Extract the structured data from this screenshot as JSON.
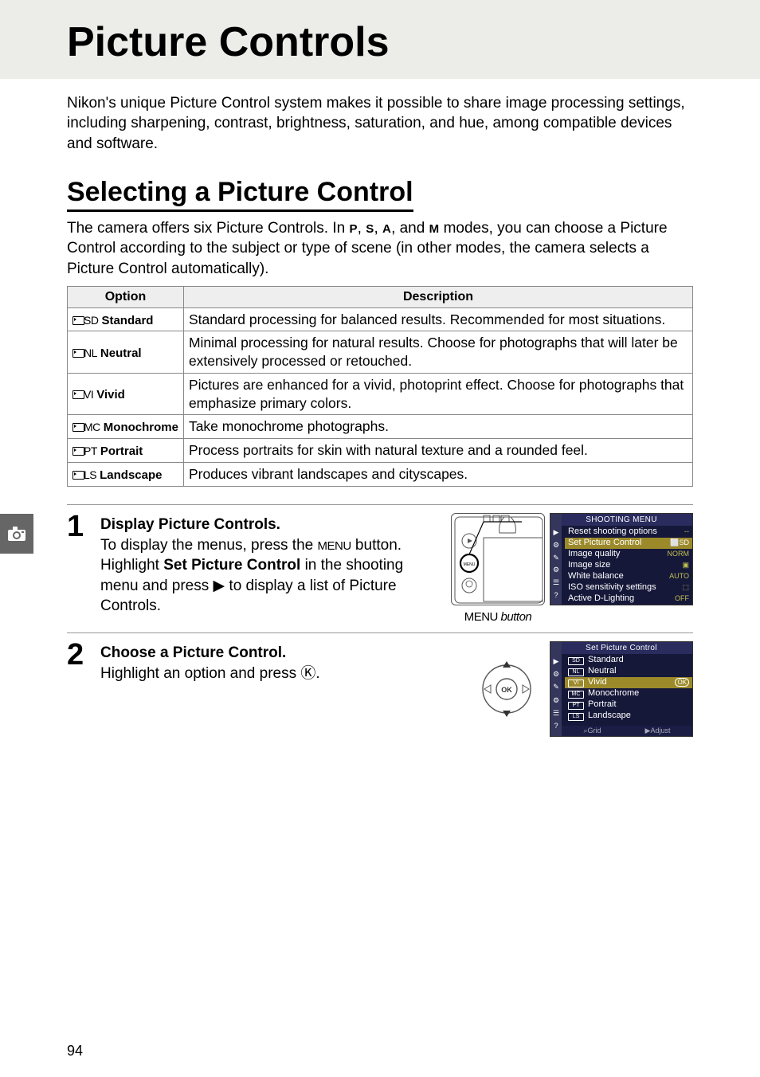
{
  "page": {
    "number": "94",
    "main_title": "Picture Controls",
    "intro": "Nikon's unique Picture Control system makes it possible to share image processing settings, including sharpening, contrast, brightness, saturation, and hue, among compatible devices and software.",
    "section_title": "Selecting a Picture Control",
    "section_text_pre": "The camera offers six Picture Controls.  In ",
    "modes": {
      "p": "P",
      "s": "S",
      "a": "A",
      "m": "M"
    },
    "section_text_post": " modes, you can choose a Picture Control according to the subject or type of scene (in other modes, the camera selects a Picture Control automatically).",
    "separators": {
      "comma": ", ",
      "and": ", and "
    }
  },
  "table": {
    "headers": {
      "option": "Option",
      "description": "Description"
    },
    "rows": [
      {
        "code": "SD",
        "label": "Standard",
        "desc": "Standard processing for balanced results.  Recommended for most situations."
      },
      {
        "code": "NL",
        "label": "Neutral",
        "desc": "Minimal processing for natural results.  Choose for photographs that will later be extensively processed or retouched."
      },
      {
        "code": "VI",
        "label": "Vivid",
        "desc": "Pictures are enhanced for a vivid, photoprint effect.  Choose for photographs that emphasize primary colors."
      },
      {
        "code": "MC",
        "label": "Monochrome",
        "desc": "Take monochrome photographs."
      },
      {
        "code": "PT",
        "label": "Portrait",
        "desc": "Process portraits for skin with natural texture and a rounded feel."
      },
      {
        "code": "LS",
        "label": "Landscape",
        "desc": "Produces vibrant landscapes and cityscapes."
      }
    ]
  },
  "steps": {
    "step1": {
      "num": "1",
      "title": "Display Picture Controls.",
      "text_pre": "To display the menus, press the ",
      "menu_label": "MENU",
      "text_mid": " button. Highlight ",
      "bold": "Set Picture Control",
      "text_post": " in the shooting menu and press ▶ to display a list of Picture Controls.",
      "caption_label": "MENU",
      "caption_suffix": " button"
    },
    "step2": {
      "num": "2",
      "title": "Choose a Picture Control.",
      "text": "Highlight an option and press Ⓚ."
    }
  },
  "screen1": {
    "title": "SHOOTING MENU",
    "items": [
      {
        "label": "Reset shooting options",
        "val": "--"
      },
      {
        "label": "Set Picture Control",
        "val": "⬜SD",
        "sel": true
      },
      {
        "label": "Image quality",
        "val": "NORM"
      },
      {
        "label": "Image size",
        "val": "▣"
      },
      {
        "label": "White balance",
        "val": "AUTO"
      },
      {
        "label": "ISO sensitivity settings",
        "val": "⬚"
      },
      {
        "label": "Active D-Lighting",
        "val": "OFF"
      }
    ],
    "sidebar_icons": [
      "▶",
      "⚙",
      "✎",
      "⚙",
      "☰",
      "?"
    ]
  },
  "screen2": {
    "title": "Set Picture Control",
    "items": [
      {
        "code": "SD",
        "label": "Standard"
      },
      {
        "code": "NL",
        "label": "Neutral"
      },
      {
        "code": "VI",
        "label": "Vivid",
        "sel": true,
        "ok": "OK"
      },
      {
        "code": "MC",
        "label": "Monochrome"
      },
      {
        "code": "PT",
        "label": "Portrait"
      },
      {
        "code": "LS",
        "label": "Landscape"
      }
    ],
    "footer": {
      "grid": "⌕Grid",
      "adjust": "▶Adjust"
    },
    "sidebar_icons": [
      "▶",
      "⚙",
      "✎",
      "⚙",
      "☰",
      "?"
    ]
  }
}
